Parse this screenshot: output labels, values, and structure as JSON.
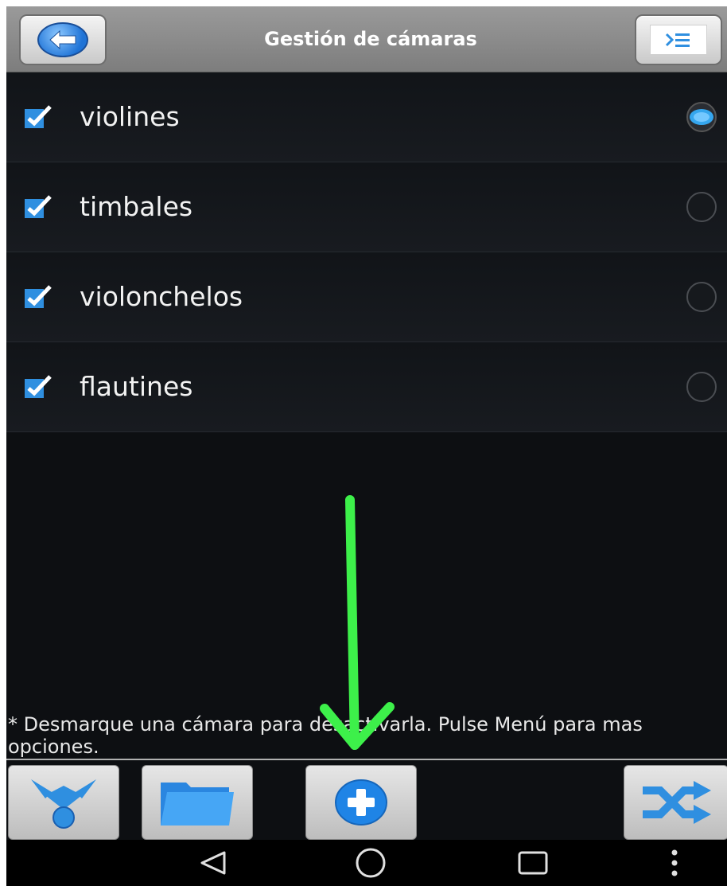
{
  "header": {
    "title": "Gestión de cámaras",
    "back_icon": "back-arrow-icon",
    "menu_icon": "list-menu-icon"
  },
  "cameras": [
    {
      "label": "violines",
      "checked": true,
      "selected": true
    },
    {
      "label": "timbales",
      "checked": true,
      "selected": false
    },
    {
      "label": "violonchelos",
      "checked": true,
      "selected": false
    },
    {
      "label": "flautines",
      "checked": true,
      "selected": false
    }
  ],
  "hint": "* Desmarque una cámara para desactivarla. Pulse Menú para mas opciones.",
  "toolbar": {
    "buttons": [
      "share-nodes-icon",
      "folder-icon",
      "add-icon",
      "shuffle-icon"
    ]
  },
  "navbar": {
    "buttons": [
      "nav-back-icon",
      "nav-home-icon",
      "nav-recents-icon",
      "nav-more-icon"
    ]
  },
  "colors": {
    "accent": "#2f8fe0",
    "annotation": "#3df04a",
    "titlebar": "#8a8a8a",
    "background": "#0d0f12"
  }
}
